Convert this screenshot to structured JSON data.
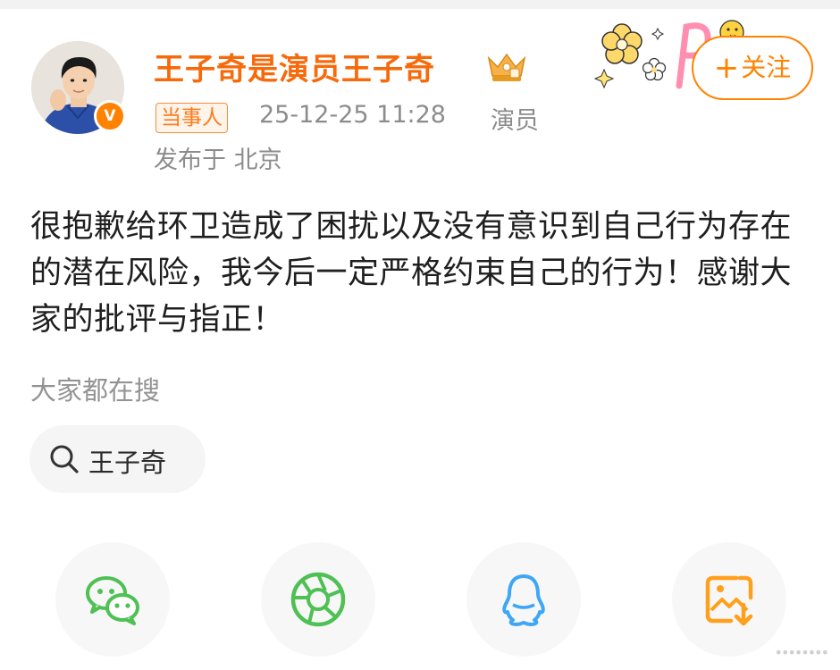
{
  "post": {
    "author": "王子奇是演员王子奇",
    "tag": "当事人",
    "timestamp": "25-12-25 11:28",
    "role": "演员",
    "location": "发布于 北京",
    "content": "很抱歉给环卫造成了困扰以及没有意识到自己行为存在的潜在风险，我今后一定严格约束自己的行为！感谢大家的批评与指正！",
    "verified_badge": "V",
    "follow": {
      "plus": "+",
      "label": "关注"
    }
  },
  "search": {
    "title": "大家都在搜",
    "chips": [
      {
        "label": "王子奇"
      }
    ]
  },
  "share": {
    "buttons": [
      {
        "icon": "wechat-icon"
      },
      {
        "icon": "moments-icon"
      },
      {
        "icon": "qq-icon"
      },
      {
        "icon": "save-image-icon"
      }
    ]
  },
  "colors": {
    "accent": "#ff8200",
    "name": "#f76a0b",
    "meta_gray": "#8c8c8c",
    "wechat_green": "#4ec054",
    "qq_blue": "#3da7f5"
  },
  "icons": {
    "avatar": "avatar",
    "crown": "crown-icon",
    "decoration": "flower-decoration"
  }
}
